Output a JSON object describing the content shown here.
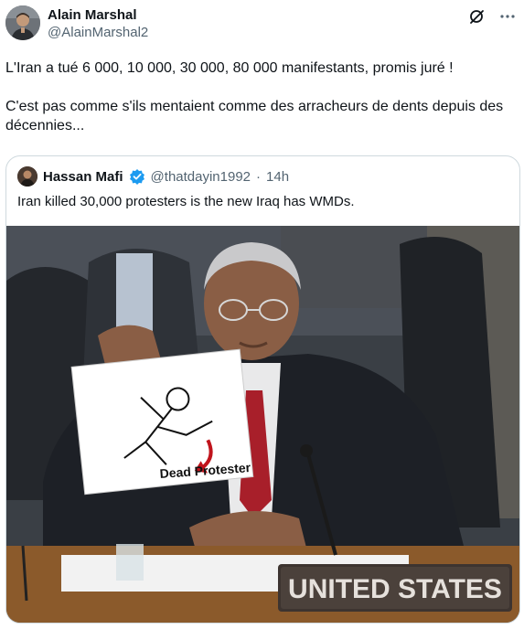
{
  "author": {
    "name": "Alain Marshal",
    "handle": "@AlainMarshal2"
  },
  "post": {
    "text": "L'Iran a tué 6 000, 10 000, 30 000, 80 000 manifestants, promis juré !\n\nC'est pas comme s'ils mentaient comme des arracheurs de dents depuis des décennies..."
  },
  "quote": {
    "name": "Hassan Mafi",
    "handle": "@thatdayin1992",
    "separator": "·",
    "time": "14h",
    "text": "Iran killed 30,000 protesters is the new Iraq has WMDs.",
    "image": {
      "sign_caption": "Dead Protester",
      "placard": "UNITED STATES"
    }
  },
  "icons": {
    "grok": "grok-icon",
    "more": "more-icon",
    "verified": "verified-badge-icon"
  },
  "colors": {
    "text": "#0f1419",
    "secondary": "#536471",
    "verified": "#1d9bf0",
    "border": "#cfd9de"
  }
}
